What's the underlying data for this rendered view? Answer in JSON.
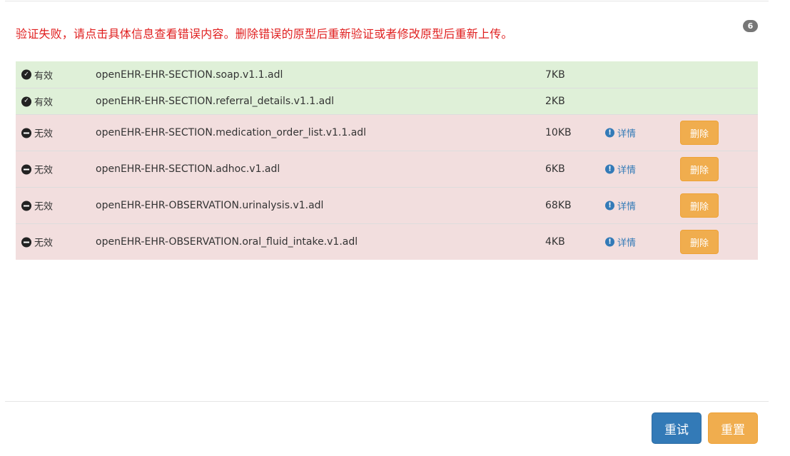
{
  "message": "验证失败，请点击具体信息查看错误内容。删除错误的原型后重新验证或者修改原型后重新上传。",
  "badge_count": "6",
  "colors": {
    "error_text": "#e02020",
    "valid_row_bg": "#dff0d8",
    "invalid_row_bg": "#f2dede",
    "primary": "#337ab7",
    "warning": "#f0ad4e"
  },
  "files": [
    {
      "status": "有效",
      "status_icon": "check-circle-icon",
      "name": "openEHR-EHR-SECTION.soap.v1.1.adl",
      "size": "7KB",
      "valid": true
    },
    {
      "status": "有效",
      "status_icon": "check-circle-icon",
      "name": "openEHR-EHR-SECTION.referral_details.v1.1.adl",
      "size": "2KB",
      "valid": true
    },
    {
      "status": "无效",
      "status_icon": "minus-circle-icon",
      "name": "openEHR-EHR-SECTION.medication_order_list.v1.1.adl",
      "size": "10KB",
      "valid": false,
      "details_label": "详情",
      "delete_label": "删除"
    },
    {
      "status": "无效",
      "status_icon": "minus-circle-icon",
      "name": "openEHR-EHR-SECTION.adhoc.v1.adl",
      "size": "6KB",
      "valid": false,
      "details_label": "详情",
      "delete_label": "删除"
    },
    {
      "status": "无效",
      "status_icon": "minus-circle-icon",
      "name": "openEHR-EHR-OBSERVATION.urinalysis.v1.adl",
      "size": "68KB",
      "valid": false,
      "details_label": "详情",
      "delete_label": "删除"
    },
    {
      "status": "无效",
      "status_icon": "minus-circle-icon",
      "name": "openEHR-EHR-OBSERVATION.oral_fluid_intake.v1.adl",
      "size": "4KB",
      "valid": false,
      "details_label": "详情",
      "delete_label": "删除"
    }
  ],
  "footer": {
    "retry_label": "重试",
    "reset_label": "重置"
  }
}
